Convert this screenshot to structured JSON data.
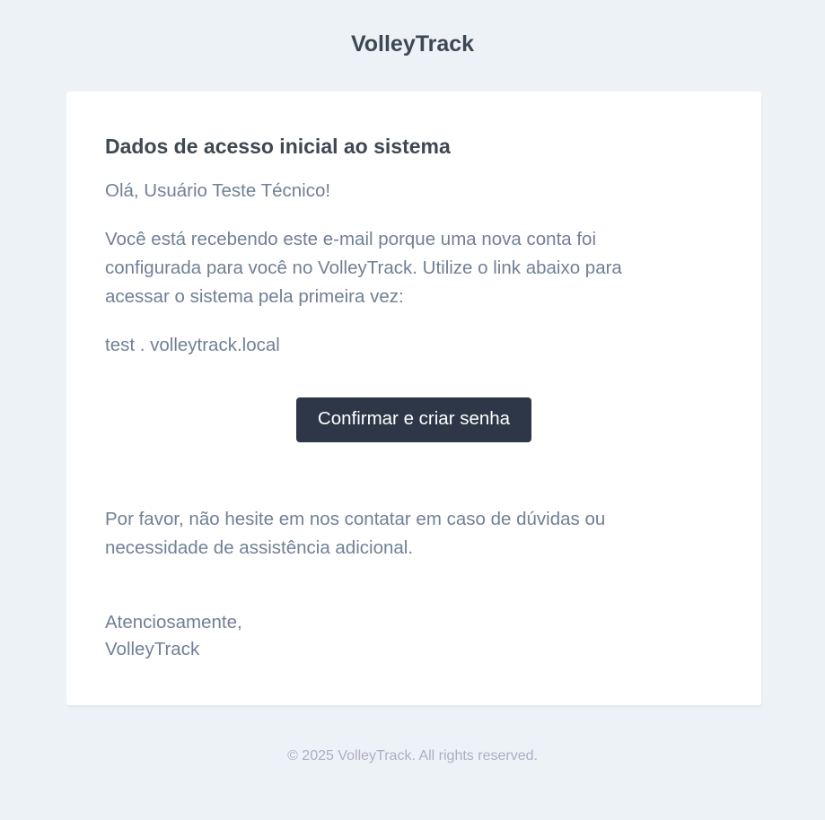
{
  "header": {
    "brand": "VolleyTrack"
  },
  "email": {
    "title": "Dados de acesso inicial ao sistema",
    "greeting": "Olá, Usuário Teste Técnico!",
    "intro": "Você está recebendo este e-mail porque uma nova conta foi configurada para você no VolleyTrack. Utilize o link abaixo para acessar o sistema pela primeira vez:",
    "link_text": "test . volleytrack.local",
    "button_label": "Confirmar e criar senha",
    "contact_text": "Por favor, não hesite em nos contatar em caso de dúvidas ou necessidade de assistência adicional.",
    "signoff": "Atenciosamente,",
    "signature": "VolleyTrack"
  },
  "footer": {
    "copyright": "© 2025 VolleyTrack. All rights reserved."
  },
  "colors": {
    "background": "#edf2f7",
    "card": "#ffffff",
    "heading": "#3d4852",
    "body_text": "#718096",
    "button": "#2d3748",
    "footer_text": "#b0adc5"
  }
}
